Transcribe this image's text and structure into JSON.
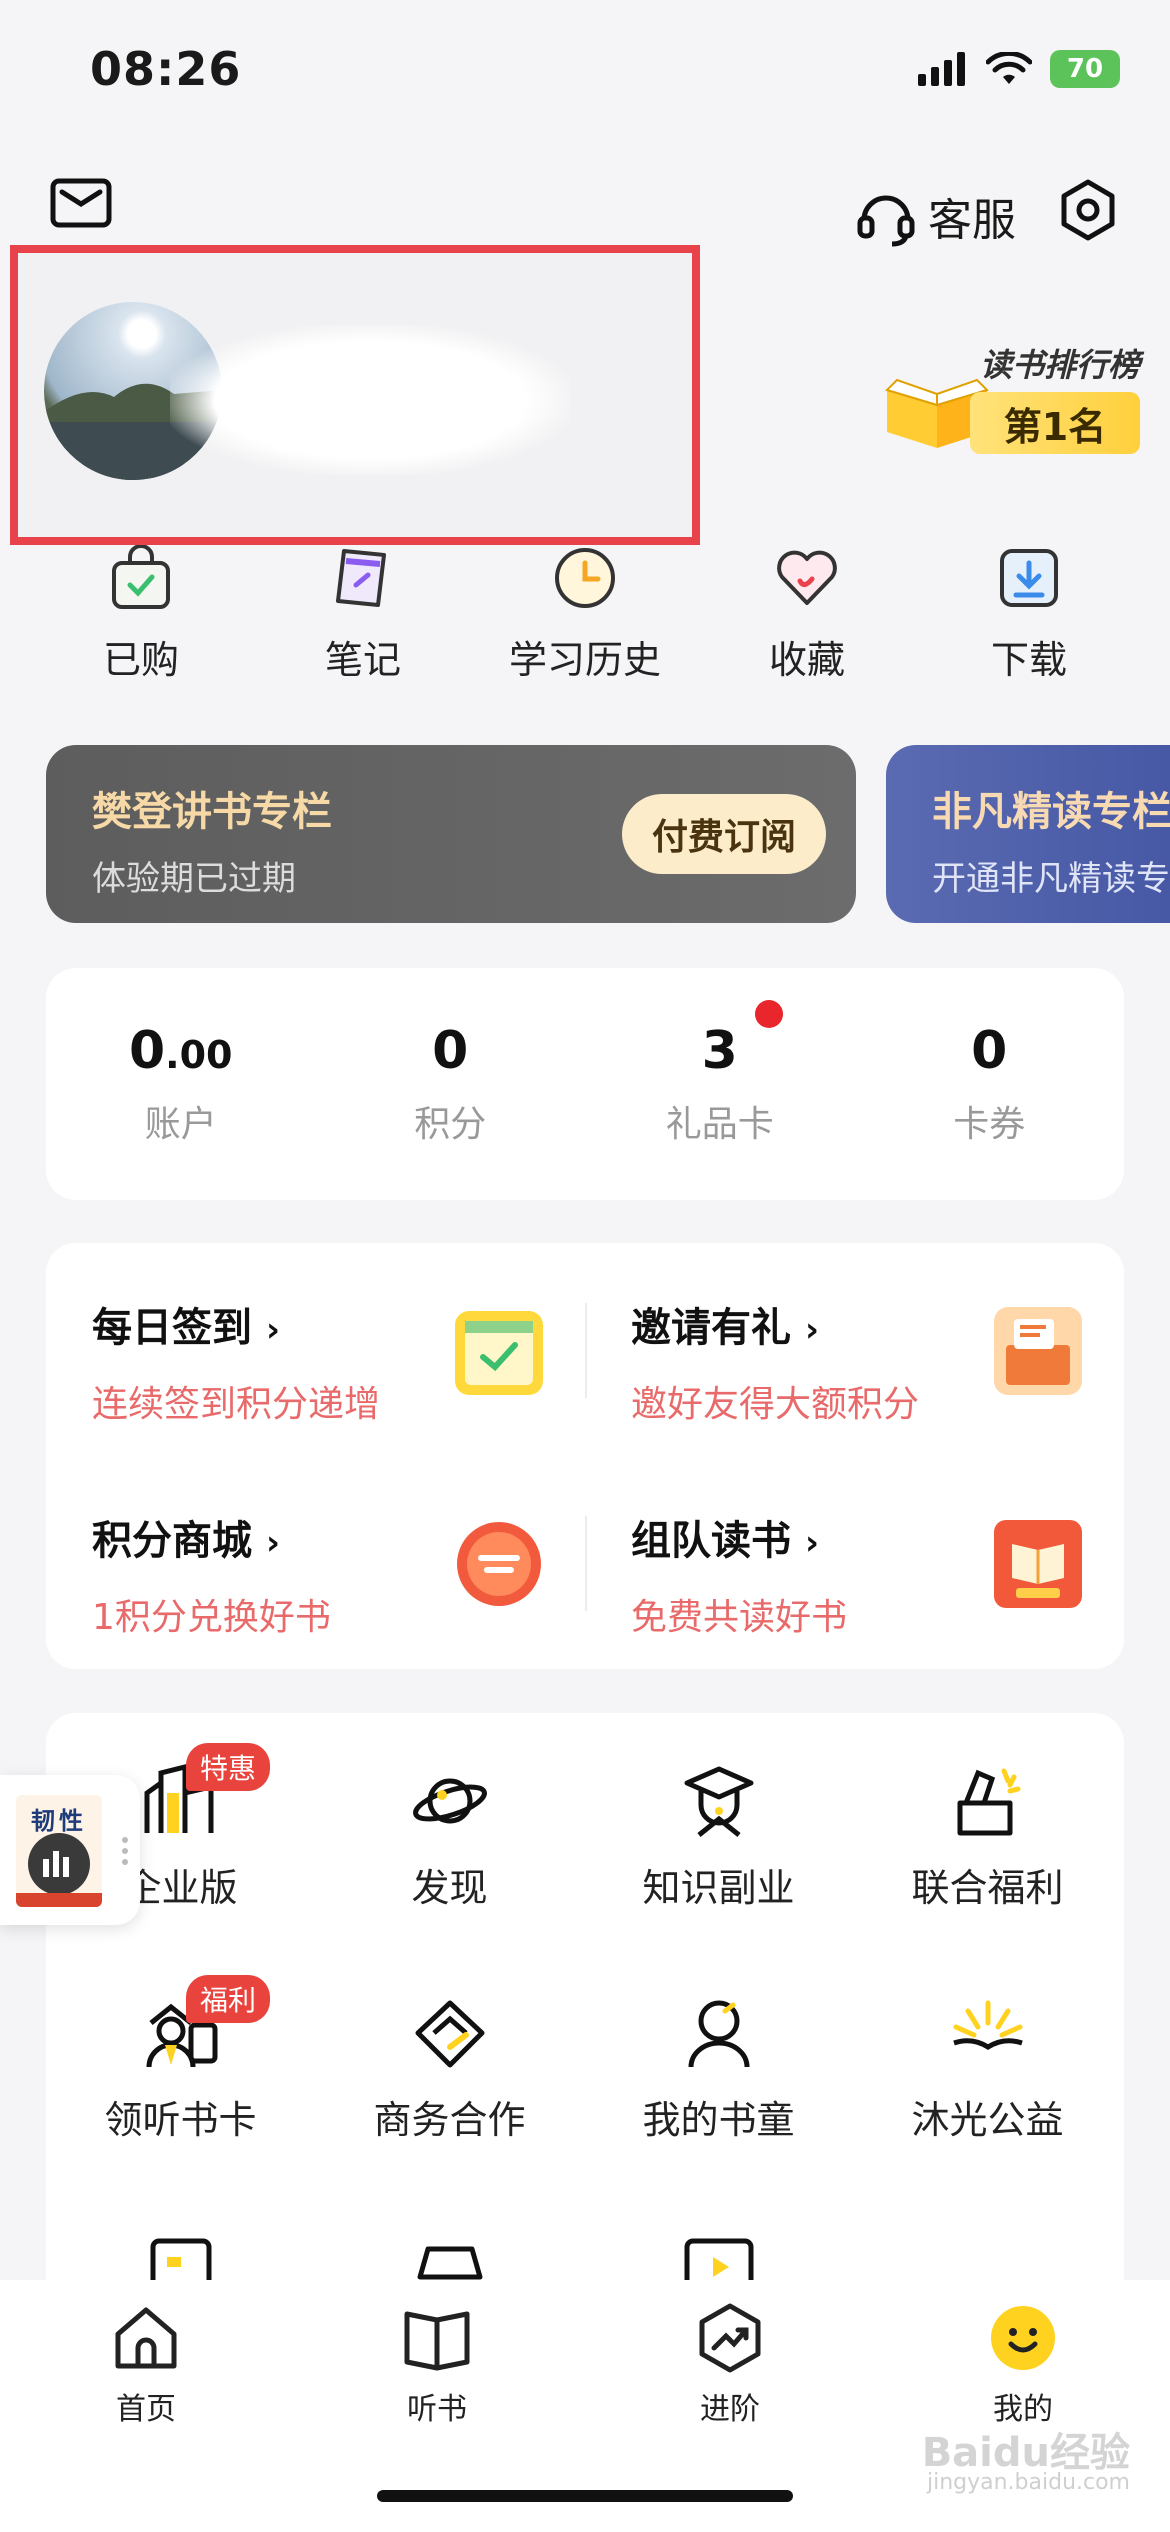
{
  "status_bar": {
    "time": "08:26",
    "battery": "70"
  },
  "header": {
    "service_label": "客服"
  },
  "ranking": {
    "title": "读书排行榜",
    "place": "第1名"
  },
  "quick_actions": [
    {
      "label": "已购"
    },
    {
      "label": "笔记"
    },
    {
      "label": "学习历史"
    },
    {
      "label": "收藏"
    },
    {
      "label": "下载"
    }
  ],
  "columns": [
    {
      "title": "樊登讲书专栏",
      "subtitle": "体验期已过期",
      "button": "付费订阅"
    },
    {
      "title": "非凡精读专栏",
      "subtitle": "开通非凡精读专栏"
    }
  ],
  "stats": [
    {
      "value_main": "0",
      "value_small": ".00",
      "label": "账户"
    },
    {
      "value_main": "0",
      "value_small": "",
      "label": "积分"
    },
    {
      "value_main": "3",
      "value_small": "",
      "label": "礼品卡"
    },
    {
      "value_main": "0",
      "value_small": "",
      "label": "卡券"
    }
  ],
  "tasks": [
    {
      "title": "每日签到",
      "subtitle": "连续签到积分递增"
    },
    {
      "title": "邀请有礼",
      "subtitle": "邀好友得大额积分"
    },
    {
      "title": "积分商城",
      "subtitle": "1积分兑换好书"
    },
    {
      "title": "组队读书",
      "subtitle": "免费共读好书"
    }
  ],
  "grid": [
    {
      "label": "企业版",
      "badge": "特惠"
    },
    {
      "label": "发现"
    },
    {
      "label": "知识副业"
    },
    {
      "label": "联合福利"
    },
    {
      "label": "领听书卡",
      "badge": "福利"
    },
    {
      "label": "商务合作"
    },
    {
      "label": "我的书童"
    },
    {
      "label": "沐光公益"
    }
  ],
  "mini_player": {
    "cover_text": "韧性"
  },
  "bottom_nav": [
    {
      "label": "首页"
    },
    {
      "label": "听书"
    },
    {
      "label": "进阶"
    },
    {
      "label": "我的"
    }
  ],
  "watermark": {
    "main": "Baidu经验",
    "sub": "jingyan.baidu.com"
  },
  "colors": {
    "accent_red": "#e8424a",
    "link_red": "#e86a6a",
    "gold": "#f6d9a6",
    "nav_active": "#ffd21f"
  }
}
